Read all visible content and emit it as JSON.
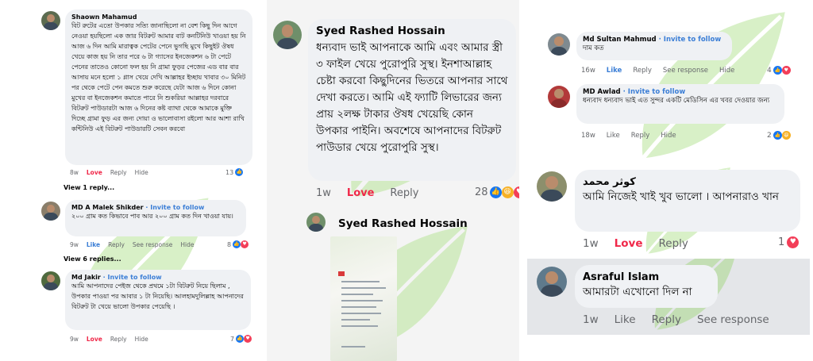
{
  "left": {
    "comments": [
      {
        "author": "Shaown Mahamud",
        "text": "বিট রুটের এতো উপকার সত্যি জানাছিলো না বেশ কিছু দিন আগে নেওয়া হয়ছিলো এক জার বিটরুট আমার বাট কনটিনিউ খাওয়া হয় নি আজ ৬ দিন আমি মারাত্বক পেটের পেনে ভুগছি মুখে কিছুইট ঔষধ খেয়ে কাজ হয় নি তার পরে ৬ টা গ্যাসের ইনজেকশন ৬ টা পেটে পেনের তাতেও কোনো ফল হয় নি গ্রামা ফুড়র পেজের এড বার বার আসায় মনে হলো ১ গ্লাস খেয়ে দেখি আল্লাহর ইচ্ছায় খাবার ৩০ মিনিট পর থেকে পেটে পেন কমতে শুরু করেছে যেটা আজ ৬ দিনে কোনা মুখের বা ইনজেকশন কমাতে পারে নি শুকরিয়া আল্লাহর দরবারে বিটরুট পাউডারটা আজ ৬ দিনের কষ্ট ব্যাথা থেকে আমাকে মুক্তি দিচ্ছে গ্রামা ফুড় এর জন্য দোয়া ও ভালোবাসা রইলো আর আশা রাখি কন্টিনিউ এই বিটরুট পাউডারটি সেবন করবো",
        "time": "8w",
        "love": "Love",
        "reply": "Reply",
        "hide": "Hide",
        "count": "13"
      },
      {
        "author": "MD A Malek Shikder",
        "follow": "· Invite to follow",
        "text": "২০০ গ্রাম কত কিভাবে পাব আর ২০০ গ্রাম কত দিন খাওয়া যায়।",
        "time": "9w",
        "like": "Like",
        "reply": "Reply",
        "see": "See response",
        "hide": "Hide",
        "count": "8"
      },
      {
        "author": "Md Jakir",
        "follow": "· Invite to follow",
        "text": "আমি আপনাদের পেইজ থেকে প্রথমে ১টা বিটরুট নিয়ে ছিলাম , উপকার পাওয়া পর আবার ১ টা নিয়েছি। আলহামদুলিল্লাহ আপনাদের বিটরুট টা খেয়ে ভালো উপকার পেয়েছি ।",
        "time": "9w",
        "love": "Love",
        "reply": "Reply",
        "hide": "Hide",
        "count": "7"
      }
    ],
    "view1": "View 1 reply...",
    "view6": "View 6 replies..."
  },
  "mid": {
    "author": "Syed Rashed Hossain",
    "text": "ধন্যবাদ ভাই আপনাকে আমি এবং আমার স্ত্রী ৩ ফাইল খেয়ে পুরোপুরি সুস্থ। ইনশাআল্লাহ চেষ্টা করবো কিছুদিনের ভিতরে আপনার সাথে দেখা করতে। আমি এই ফ্যাটি লিভারের জন্য প্রায় ২লক্ষ টাকার ঔষধ খেয়েছি কোন উপকার পাইনি। অবশেষে আপনাদের বিটরুট পাউডার খেয়ে পুরোপুরি সুস্থ।",
    "time": "1w",
    "love": "Love",
    "reply": "Reply",
    "count": "28",
    "author2": "Syed Rashed Hossain"
  },
  "right": {
    "comments": [
      {
        "author": "Md Sultan Mahmud",
        "follow": "· Invite to follow",
        "text": "দাম কত",
        "time": "16w",
        "like": "Like",
        "reply": "Reply",
        "see": "See response",
        "hide": "Hide",
        "count": "4"
      },
      {
        "author": "MD Awlad",
        "follow": "· Invite to follow",
        "text": "ধন্যবাদ ধন্যবাদ ভাই এত সুন্দর একটি মেডিসিন এর খবর দেওয়ার জন্য",
        "time": "18w",
        "like": "Like",
        "reply": "Reply",
        "hide": "Hide",
        "count": "2"
      }
    ],
    "c3": {
      "author": "كوثر محمد",
      "text": "আমি নিজেই খাই খুব ভালো । আপনারাও খান",
      "time": "1w",
      "love": "Love",
      "reply": "Reply",
      "count": "1"
    },
    "c4": {
      "author": "Asraful Islam",
      "text": "আমারটা এখোনো দিল না",
      "time": "1w",
      "like": "Like",
      "reply": "Reply",
      "see": "See response"
    }
  },
  "colors": {
    "bubble": "#eff1f4",
    "love": "#f02849",
    "link": "#3b7ed6",
    "muted": "#65676b",
    "leaf": "#8fd06a"
  }
}
